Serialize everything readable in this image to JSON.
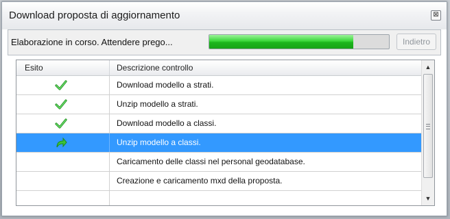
{
  "window": {
    "title": "Download proposta di aggiornamento",
    "close_glyph": "⊠"
  },
  "toolbar": {
    "status_text": "Elaborazione in corso. Attendere prego...",
    "progress_percent": 80,
    "back_label": "Indietro"
  },
  "table": {
    "columns": [
      "Esito",
      "Descrizione controllo"
    ],
    "rows": [
      {
        "status": "done",
        "status_icon": "green-check-icon",
        "description": "Download modello a strati."
      },
      {
        "status": "done",
        "status_icon": "green-check-icon",
        "description": "Unzip modello a strati."
      },
      {
        "status": "done",
        "status_icon": "green-check-icon",
        "description": "Download modello a classi."
      },
      {
        "status": "running",
        "status_icon": "green-arrow-icon",
        "description": "Unzip modello a classi.",
        "selected": true
      },
      {
        "status": "pending",
        "status_icon": "",
        "description": "Caricamento delle classi nel personal geodatabase."
      },
      {
        "status": "pending",
        "status_icon": "",
        "description": "Creazione e caricamento mxd della proposta."
      },
      {
        "status": "pending",
        "status_icon": "",
        "description": ""
      }
    ]
  },
  "colors": {
    "selection": "#3399ff",
    "progress": "#2ecc2e"
  }
}
